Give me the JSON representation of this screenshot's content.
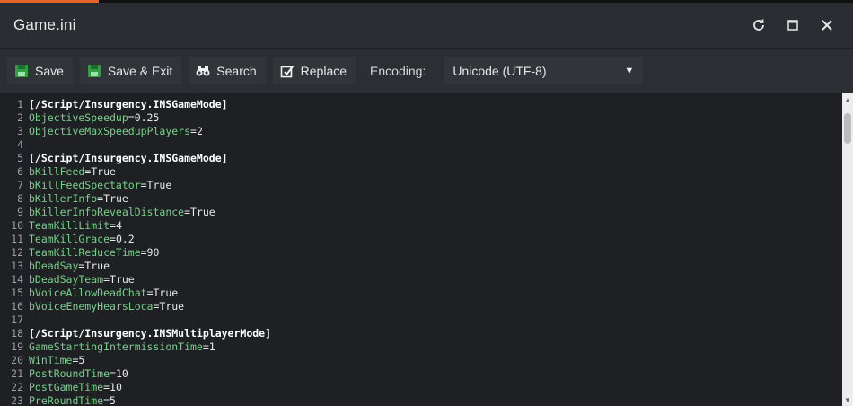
{
  "window": {
    "title": "Game.ini"
  },
  "window_controls": {
    "refresh": "refresh-icon",
    "maximize": "maximize-icon",
    "close": "close-icon"
  },
  "toolbar": {
    "save_label": "Save",
    "save_exit_label": "Save & Exit",
    "search_label": "Search",
    "replace_label": "Replace",
    "encoding_label": "Encoding:",
    "encoding_value": "Unicode (UTF-8)"
  },
  "editor": {
    "lines": [
      {
        "n": "1",
        "type": "section",
        "text": "[/Script/Insurgency.INSGameMode]"
      },
      {
        "n": "2",
        "type": "kv",
        "key": "ObjectiveSpeedup",
        "val": "=0.25"
      },
      {
        "n": "3",
        "type": "kv",
        "key": "ObjectiveMaxSpeedupPlayers",
        "val": "=2"
      },
      {
        "n": "4",
        "type": "blank"
      },
      {
        "n": "5",
        "type": "section",
        "text": "[/Script/Insurgency.INSGameMode]"
      },
      {
        "n": "6",
        "type": "kv",
        "key": "bKillFeed",
        "val": "=True"
      },
      {
        "n": "7",
        "type": "kv",
        "key": "bKillFeedSpectator",
        "val": "=True"
      },
      {
        "n": "8",
        "type": "kv",
        "key": "bKillerInfo",
        "val": "=True"
      },
      {
        "n": "9",
        "type": "kv",
        "key": "bKillerInfoRevealDistance",
        "val": "=True"
      },
      {
        "n": "10",
        "type": "kv",
        "key": "TeamKillLimit",
        "val": "=4"
      },
      {
        "n": "11",
        "type": "kv",
        "key": "TeamKillGrace",
        "val": "=0.2"
      },
      {
        "n": "12",
        "type": "kv",
        "key": "TeamKillReduceTime",
        "val": "=90"
      },
      {
        "n": "13",
        "type": "kv",
        "key": "bDeadSay",
        "val": "=True"
      },
      {
        "n": "14",
        "type": "kv",
        "key": "bDeadSayTeam",
        "val": "=True"
      },
      {
        "n": "15",
        "type": "kv",
        "key": "bVoiceAllowDeadChat",
        "val": "=True"
      },
      {
        "n": "16",
        "type": "kv",
        "key": "bVoiceEnemyHearsLoca",
        "val": "=True"
      },
      {
        "n": "17",
        "type": "blank"
      },
      {
        "n": "18",
        "type": "section",
        "text": "[/Script/Insurgency.INSMultiplayerMode]"
      },
      {
        "n": "19",
        "type": "kv",
        "key": "GameStartingIntermissionTime",
        "val": "=1"
      },
      {
        "n": "20",
        "type": "kv",
        "key": "WinTime",
        "val": "=5"
      },
      {
        "n": "21",
        "type": "kv",
        "key": "PostRoundTime",
        "val": "=10"
      },
      {
        "n": "22",
        "type": "kv",
        "key": "PostGameTime",
        "val": "=10"
      },
      {
        "n": "23",
        "type": "kv",
        "key": "PreRoundTime",
        "val": "=5"
      }
    ]
  },
  "colors": {
    "accent": "#e8622c",
    "key": "#78d08a",
    "section": "#ffffff",
    "save_icon": "#2f9e44"
  }
}
